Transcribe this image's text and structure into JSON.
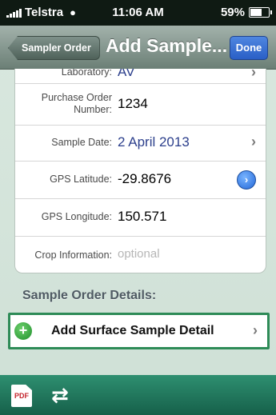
{
  "status_bar": {
    "carrier": "Telstra",
    "time": "11:06 AM",
    "battery": "59%",
    "battery_level": 0.59
  },
  "nav": {
    "back_label": "Sampler Order",
    "title": "Add Sample...",
    "done_label": "Done"
  },
  "form": {
    "laboratory": {
      "label": "Laboratory:",
      "value": "AV"
    },
    "purchase_order": {
      "label_line1": "Purchase Order",
      "label_line2": "Number:",
      "value": "1234"
    },
    "sample_date": {
      "label": "Sample Date:",
      "value": "2 April 2013"
    },
    "gps_latitude": {
      "label": "GPS Latitude:",
      "value": "-29.8676"
    },
    "gps_longitude": {
      "label": "GPS Longitude:",
      "value": "150.571"
    },
    "crop_information": {
      "label": "Crop Information:",
      "placeholder": "optional"
    }
  },
  "section": {
    "header": "Sample Order Details:",
    "add_surface_label": "Add Surface Sample Detail"
  },
  "toolbar": {
    "pdf_label": "PDF"
  },
  "icons": [
    "signal-icon",
    "wifi-icon",
    "battery-icon",
    "chevron-right-icon",
    "gps-detail-icon",
    "add-icon",
    "pdf-icon",
    "sync-icon"
  ],
  "colors": {
    "accent_green": "#2e8b57",
    "value_blue": "#2c3f8c",
    "done_blue": "#2a5fc6",
    "bottom_bar": "#16604a"
  }
}
